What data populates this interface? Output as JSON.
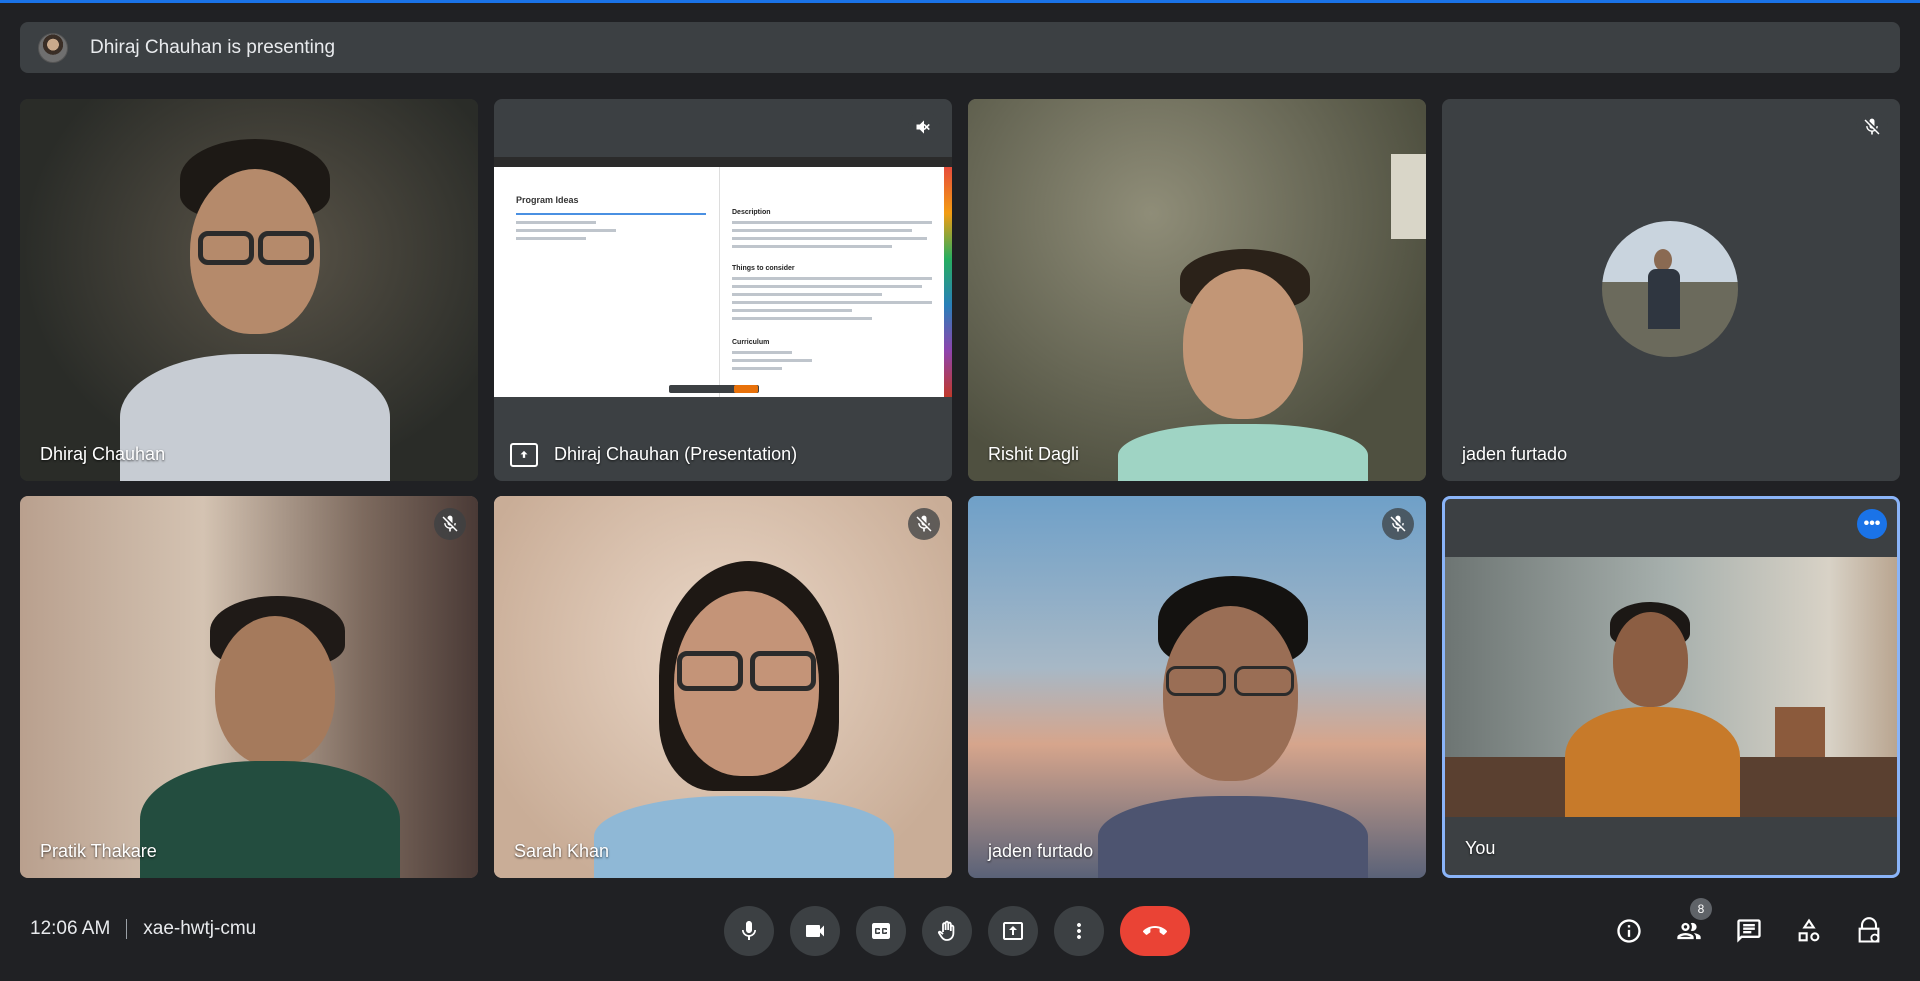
{
  "presenting_banner": {
    "text": "Dhiraj Chauhan is presenting"
  },
  "tiles": [
    {
      "name": "Dhiraj Chauhan"
    },
    {
      "name": "Dhiraj Chauhan (Presentation)",
      "doc_title": "Program Ideas",
      "sections": [
        "Description",
        "Things to consider",
        "Curriculum"
      ]
    },
    {
      "name": "Rishit Dagli"
    },
    {
      "name": "jaden furtado"
    },
    {
      "name": "Pratik Thakare"
    },
    {
      "name": "Sarah Khan"
    },
    {
      "name": "jaden furtado"
    },
    {
      "name": "You"
    }
  ],
  "bottom": {
    "time": "12:06 AM",
    "meeting_code": "xae-hwtj-cmu",
    "participant_count": "8"
  },
  "colors": {
    "accent": "#1a73e8",
    "end_call": "#ea4335",
    "tile_bg": "#3c4043",
    "bg": "#202124",
    "you_border": "#8ab4f8"
  },
  "icons": {
    "controls": [
      "mic-icon",
      "camera-icon",
      "captions-icon",
      "raise-hand-icon",
      "present-icon",
      "more-options-icon",
      "end-call-icon"
    ],
    "right": [
      "info-icon",
      "people-icon",
      "chat-icon",
      "activities-icon",
      "host-controls-icon"
    ]
  }
}
